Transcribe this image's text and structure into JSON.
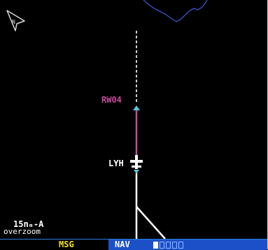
{
  "map": {
    "waypoint_label": "RW04",
    "airport_label": "LYH",
    "scale_value": "15nₘ-A",
    "scale_note": "overzoom",
    "icons": {
      "north": "north-arrow-icon",
      "aircraft": "aircraft-icon",
      "airport": "airport-icon",
      "waypoint": "waypoint-triangle-icon"
    },
    "colors": {
      "active_leg": "#c64b9c",
      "terrain_outline": "#3b55c8",
      "route": "#ffffff"
    }
  },
  "status_bar": {
    "msg_label": "MSG",
    "nav_label": "NAV",
    "page_count": 5,
    "active_page": 1,
    "colors": {
      "msg_text": "#f2e11a",
      "nav_bg": "#1c50c8"
    }
  }
}
